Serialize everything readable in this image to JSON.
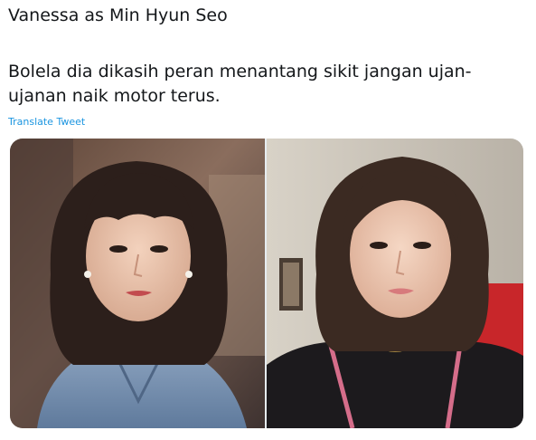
{
  "tweet": {
    "title_line": "Vanessa as Min Hyun Seo",
    "body_line_1": "Bolela dia dikasih peran menantang sikit jangan ujan-",
    "body_line_2": "ujanan naik motor terus.",
    "translate_label": "Translate Tweet"
  },
  "media": {
    "left_photo": {
      "subject": "woman with shoulder-length bangs hair, pearl earrings, light blue denim shirt"
    },
    "right_photo": {
      "subject": "woman with short wavy brown hair, black top with pink straps, gold necklace"
    }
  },
  "colors": {
    "text": "#14171a",
    "link": "#1b95e0"
  }
}
